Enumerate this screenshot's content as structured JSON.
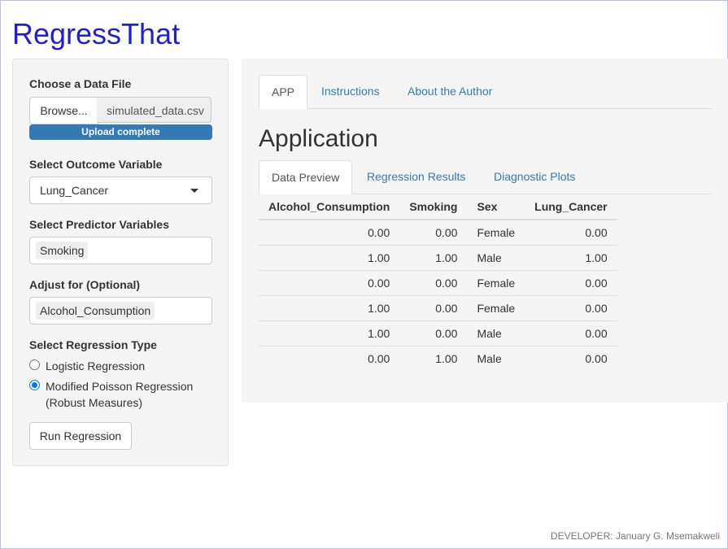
{
  "app_title": "RegressThat",
  "sidebar": {
    "file_label": "Choose a Data File",
    "browse_label": "Browse...",
    "file_name": "simulated_data.csv",
    "upload_status": "Upload complete",
    "upload_progress": 1.0,
    "outcome_label": "Select Outcome Variable",
    "outcome_value": "Lung_Cancer",
    "predictor_label": "Select Predictor Variables",
    "predictor_tag": "Smoking",
    "adjust_label": "Adjust for (Optional)",
    "adjust_tag": "Alcohol_Consumption",
    "regression_type_label": "Select Regression Type",
    "options": [
      {
        "label": "Logistic Regression",
        "selected": false
      },
      {
        "label": "Modified Poisson Regression",
        "label2": "(Robust Measures)",
        "selected": true
      }
    ],
    "run_button": "Run Regression"
  },
  "main": {
    "tabs": [
      {
        "label": "APP",
        "active": true
      },
      {
        "label": "Instructions",
        "active": false
      },
      {
        "label": "About the Author",
        "active": false
      }
    ],
    "section_title": "Application",
    "subtabs": [
      {
        "label": "Data Preview",
        "active": true
      },
      {
        "label": "Regression Results",
        "active": false
      },
      {
        "label": "Diagnostic Plots",
        "active": false
      }
    ],
    "table": {
      "headers": [
        "Alcohol_Consumption",
        "Smoking",
        "Sex",
        "Lung_Cancer"
      ],
      "rows": [
        [
          "0.00",
          "0.00",
          "Female",
          "0.00"
        ],
        [
          "1.00",
          "1.00",
          "Male",
          "1.00"
        ],
        [
          "0.00",
          "0.00",
          "Female",
          "0.00"
        ],
        [
          "1.00",
          "0.00",
          "Female",
          "0.00"
        ],
        [
          "1.00",
          "0.00",
          "Male",
          "0.00"
        ],
        [
          "0.00",
          "1.00",
          "Male",
          "0.00"
        ]
      ]
    }
  },
  "footer": "DEVELOPER: January G. Msemakweli",
  "colors": {
    "title": "#1f1fd6",
    "link": "#337ab7",
    "progress": "#337ab7",
    "radio_selected": "#0075ff"
  }
}
